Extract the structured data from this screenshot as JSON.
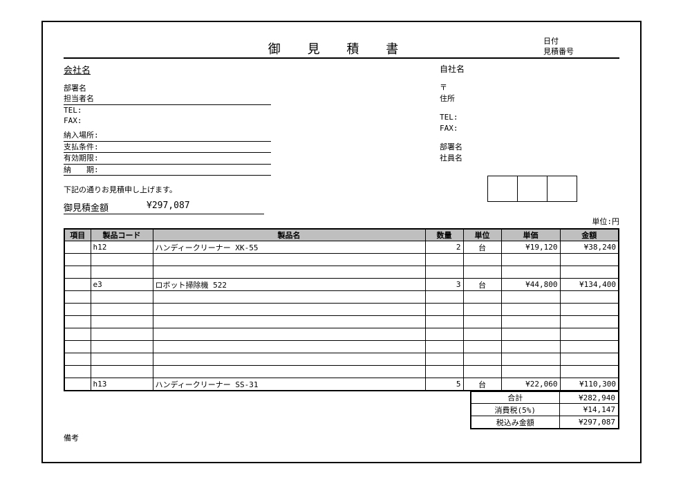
{
  "meta": {
    "date_label": "日付",
    "quote_no_label": "見積番号"
  },
  "title": "御 見 積 書",
  "client": {
    "company_label": "会社名",
    "dept_label": "部署名",
    "person_label": "担当者名",
    "tel_label": "TEL:",
    "fax_label": "FAX:"
  },
  "supplier": {
    "company_label": "自社名",
    "postal_label": "〒",
    "address_label": "住所",
    "tel_label": "TEL:",
    "fax_label": "FAX:",
    "dept_label": "部署名",
    "staff_label": "社員名"
  },
  "terms": {
    "delivery_place": "納入場所:",
    "payment": "支払条件:",
    "validity": "有効期限:",
    "due": "納　　期:"
  },
  "notice": "下記の通りお見積申し上げます。",
  "total_label": "御見積金額",
  "total_value": "¥297,087",
  "unit_note": "単位:円",
  "columns": {
    "no": "項目",
    "code": "製品コード",
    "name": "製品名",
    "qty": "数量",
    "unit": "単位",
    "price": "単価",
    "amount": "金額"
  },
  "rows": [
    {
      "no": "",
      "code": "h12",
      "name": "ハンディークリーナー XK-55",
      "qty": "2",
      "unit": "台",
      "price": "¥19,120",
      "amount": "¥38,240"
    },
    {
      "no": "",
      "code": "",
      "name": "",
      "qty": "",
      "unit": "",
      "price": "",
      "amount": ""
    },
    {
      "no": "",
      "code": "",
      "name": "",
      "qty": "",
      "unit": "",
      "price": "",
      "amount": ""
    },
    {
      "no": "",
      "code": "e3",
      "name": "ロボット掃除機 522",
      "qty": "3",
      "unit": "台",
      "price": "¥44,800",
      "amount": "¥134,400"
    },
    {
      "no": "",
      "code": "",
      "name": "",
      "qty": "",
      "unit": "",
      "price": "",
      "amount": ""
    },
    {
      "no": "",
      "code": "",
      "name": "",
      "qty": "",
      "unit": "",
      "price": "",
      "amount": ""
    },
    {
      "no": "",
      "code": "",
      "name": "",
      "qty": "",
      "unit": "",
      "price": "",
      "amount": ""
    },
    {
      "no": "",
      "code": "",
      "name": "",
      "qty": "",
      "unit": "",
      "price": "",
      "amount": ""
    },
    {
      "no": "",
      "code": "",
      "name": "",
      "qty": "",
      "unit": "",
      "price": "",
      "amount": ""
    },
    {
      "no": "",
      "code": "",
      "name": "",
      "qty": "",
      "unit": "",
      "price": "",
      "amount": ""
    },
    {
      "no": "",
      "code": "",
      "name": "",
      "qty": "",
      "unit": "",
      "price": "",
      "amount": ""
    },
    {
      "no": "",
      "code": "h13",
      "name": "ハンディークリーナー SS-31",
      "qty": "5",
      "unit": "台",
      "price": "¥22,060",
      "amount": "¥110,300"
    }
  ],
  "summary": {
    "subtotal_label": "合計",
    "subtotal_value": "¥282,940",
    "tax_label": "消費税(5%)",
    "tax_value": "¥14,147",
    "grand_label": "税込み金額",
    "grand_value": "¥297,087"
  },
  "remarks_label": "備考"
}
